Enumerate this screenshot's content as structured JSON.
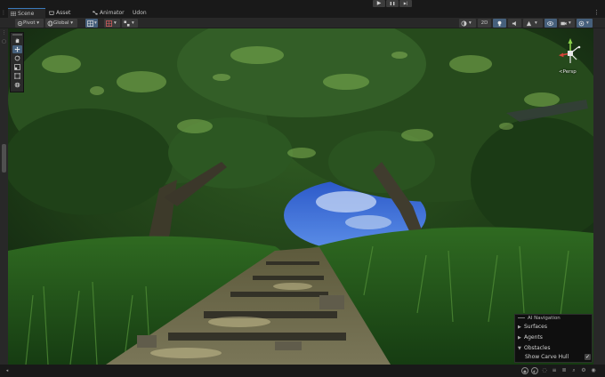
{
  "playbar": {
    "buttons": [
      {
        "icon": "play-icon",
        "glyph": "▶"
      },
      {
        "icon": "pause-icon",
        "glyph": "❚❚"
      },
      {
        "icon": "step-icon",
        "glyph": "▶|"
      }
    ]
  },
  "tabs": [
    {
      "label": "Scene",
      "icon": "scene-grid-icon",
      "active": true
    },
    {
      "label": "Asset Store",
      "icon": "asset-store-icon",
      "active": false
    },
    {
      "label": "Animator",
      "icon": "animator-icon",
      "active": false
    },
    {
      "label": "Udon Graph",
      "icon": "",
      "active": false
    }
  ],
  "toolbar": {
    "pivot_label": "Pivot",
    "global_label": "Global",
    "dropdown_glyph": "▾",
    "mode_2d_label": "2D"
  },
  "overlay": {
    "persp_label": "<Persp"
  },
  "ai_navigation": {
    "title": "AI Navigation",
    "items": [
      {
        "label": "Surfaces",
        "expanded": false
      },
      {
        "label": "Agents",
        "expanded": false
      },
      {
        "label": "Obstacles",
        "expanded": true
      }
    ],
    "option_label": "Show Carve Hull",
    "option_checked": true,
    "caret_collapsed": "▶",
    "caret_expanded": "▼",
    "check_glyph": "✓"
  },
  "colors": {
    "accent": "#3a79bb",
    "selected_tool": "#46607c",
    "panel_bg": "#282828",
    "editor_bg": "#191919",
    "sky": "#3a6fd6"
  }
}
